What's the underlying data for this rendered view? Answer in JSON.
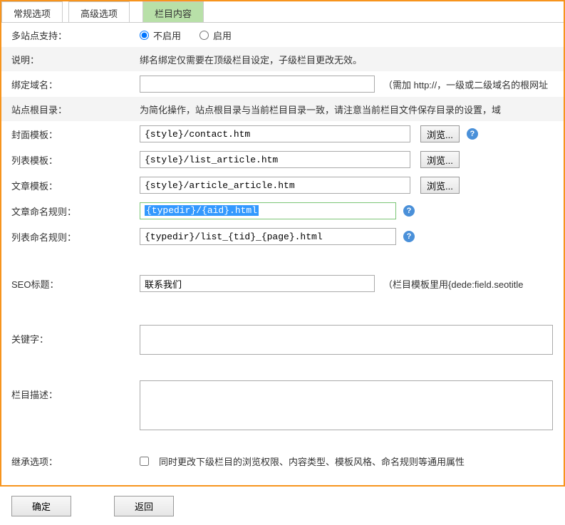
{
  "tabs": {
    "general": "常规选项",
    "advanced": "高级选项",
    "column": "栏目内容"
  },
  "labels": {
    "multisite": "多站点支持：",
    "desc": "说明：",
    "bind_domain": "绑定域名：",
    "site_root": "站点根目录：",
    "cover_tpl": "封面模板：",
    "list_tpl": "列表模板：",
    "article_tpl": "文章模板：",
    "article_rule": "文章命名规则：",
    "list_rule": "列表命名规则：",
    "seo_title": "SEO标题：",
    "keywords": "关键字：",
    "col_desc": "栏目描述：",
    "inherit": "继承选项："
  },
  "values": {
    "multisite_off": "不启用",
    "multisite_on": "启用",
    "desc_text": "绑名绑定仅需要在顶级栏目设定，子级栏目更改无效。",
    "bind_domain_note": "（需加 http://，一级或二级域名的根网址",
    "site_root_text": "为简化操作，站点根目录与当前栏目目录一致，请注意当前栏目文件保存目录的设置，域",
    "cover_tpl": "{style}/contact.htm",
    "list_tpl": "{style}/list_article.htm",
    "article_tpl": "{style}/article_article.htm",
    "article_rule": "{typedir}/{aid}.html",
    "list_rule": "{typedir}/list_{tid}_{page}.html",
    "seo_title": "联系我们",
    "seo_note": "（栏目模板里用{dede:field.seotitle",
    "browse": "浏览...",
    "inherit_text": "同时更改下级栏目的浏览权限、内容类型、模板风格、命名规则等通用属性"
  },
  "footer": {
    "ok": "确定",
    "back": "返回"
  }
}
